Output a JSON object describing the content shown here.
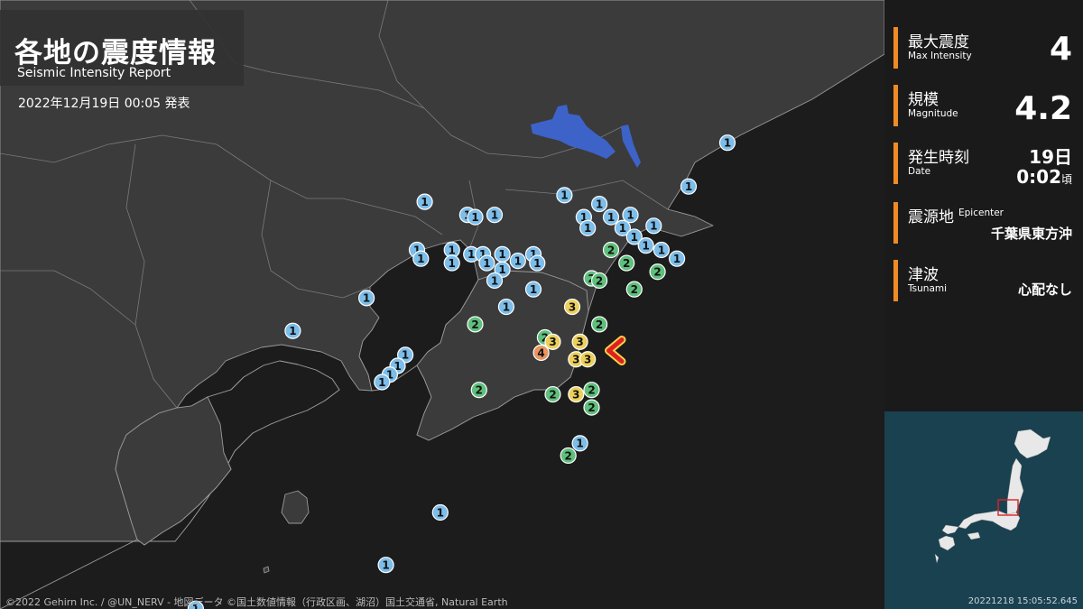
{
  "header": {
    "title_ja": "各地の震度情報",
    "title_en": "Seismic Intensity Report",
    "issued": "2022年12月19日 00:05 発表"
  },
  "credit": "©2022 Gehirn Inc. / @UN_NERV - 地図データ ©国土数値情報（行政区画、湖沼）国土交通省, Natural Earth",
  "panel": {
    "max_intensity": {
      "label_ja": "最大震度",
      "label_en": "Max Intensity",
      "value": "4"
    },
    "magnitude": {
      "label_ja": "規模",
      "label_en": "Magnitude",
      "value": "4.2"
    },
    "time": {
      "label_ja": "発生時刻",
      "label_en": "Date",
      "day": "19日",
      "time": "0:02",
      "suffix": "頃"
    },
    "epicenter": {
      "label_ja": "震源地",
      "label_en": "Epicenter",
      "value": "千葉県東方沖"
    },
    "tsunami": {
      "label_ja": "津波",
      "label_en": "Tsunami",
      "value": "心配なし"
    }
  },
  "inset": {
    "timestamp": "20221218 15:05:52.645"
  },
  "colors": {
    "land": "#3a3a3a",
    "sea": "#1c1c1c",
    "lake": "#3d63c9",
    "accent": "#f08a24",
    "int1": "#7cbde9",
    "int2": "#5fbf7c",
    "int3": "#ecd05a",
    "int4": "#e89560",
    "epicenter": "#e02020"
  },
  "stations": [
    {
      "i": 1,
      "lon": 140.8,
      "lat": 35.955
    },
    {
      "i": 1,
      "lon": 140.7,
      "lat": 35.855
    },
    {
      "i": 1,
      "lon": 140.38,
      "lat": 35.835
    },
    {
      "i": 1,
      "lon": 140.47,
      "lat": 35.815
    },
    {
      "i": 1,
      "lon": 140.55,
      "lat": 35.79
    },
    {
      "i": 1,
      "lon": 140.43,
      "lat": 35.785
    },
    {
      "i": 1,
      "lon": 140.5,
      "lat": 35.785
    },
    {
      "i": 1,
      "lon": 140.61,
      "lat": 35.765
    },
    {
      "i": 1,
      "lon": 140.44,
      "lat": 35.76
    },
    {
      "i": 1,
      "lon": 140.53,
      "lat": 35.76
    },
    {
      "i": 1,
      "lon": 140.56,
      "lat": 35.74
    },
    {
      "i": 1,
      "lon": 140.59,
      "lat": 35.72
    },
    {
      "i": 1,
      "lon": 140.63,
      "lat": 35.71
    },
    {
      "i": 1,
      "lon": 140.67,
      "lat": 35.69
    },
    {
      "i": 1,
      "lon": 140.02,
      "lat": 35.82
    },
    {
      "i": 1,
      "lon": 140.13,
      "lat": 35.79
    },
    {
      "i": 1,
      "lon": 140.15,
      "lat": 35.785
    },
    {
      "i": 1,
      "lon": 140.2,
      "lat": 35.79
    },
    {
      "i": 1,
      "lon": 140.0,
      "lat": 35.71
    },
    {
      "i": 1,
      "lon": 140.01,
      "lat": 35.69
    },
    {
      "i": 1,
      "lon": 140.09,
      "lat": 35.71
    },
    {
      "i": 1,
      "lon": 140.14,
      "lat": 35.7
    },
    {
      "i": 1,
      "lon": 140.17,
      "lat": 35.7
    },
    {
      "i": 1,
      "lon": 140.18,
      "lat": 35.68
    },
    {
      "i": 1,
      "lon": 140.22,
      "lat": 35.7
    },
    {
      "i": 1,
      "lon": 140.26,
      "lat": 35.685
    },
    {
      "i": 1,
      "lon": 140.3,
      "lat": 35.7
    },
    {
      "i": 1,
      "lon": 140.09,
      "lat": 35.68
    },
    {
      "i": 1,
      "lon": 140.22,
      "lat": 35.665
    },
    {
      "i": 1,
      "lon": 140.31,
      "lat": 35.68
    },
    {
      "i": 1,
      "lon": 140.2,
      "lat": 35.64
    },
    {
      "i": 1,
      "lon": 140.3,
      "lat": 35.62
    },
    {
      "i": 1,
      "lon": 140.23,
      "lat": 35.58
    },
    {
      "i": 1,
      "lon": 139.87,
      "lat": 35.6
    },
    {
      "i": 1,
      "lon": 139.68,
      "lat": 35.525
    },
    {
      "i": 1,
      "lon": 139.97,
      "lat": 35.47
    },
    {
      "i": 1,
      "lon": 139.95,
      "lat": 35.445
    },
    {
      "i": 1,
      "lon": 139.93,
      "lat": 35.425
    },
    {
      "i": 1,
      "lon": 139.91,
      "lat": 35.408
    },
    {
      "i": 1,
      "lon": 140.42,
      "lat": 35.268
    },
    {
      "i": 1,
      "lon": 140.06,
      "lat": 35.11
    },
    {
      "i": 1,
      "lon": 139.92,
      "lat": 34.99
    },
    {
      "i": 1,
      "lon": 139.43,
      "lat": 34.89
    },
    {
      "i": 2,
      "lon": 140.5,
      "lat": 35.71
    },
    {
      "i": 2,
      "lon": 140.54,
      "lat": 35.68
    },
    {
      "i": 2,
      "lon": 140.62,
      "lat": 35.66
    },
    {
      "i": 2,
      "lon": 140.45,
      "lat": 35.645
    },
    {
      "i": 2,
      "lon": 140.47,
      "lat": 35.64
    },
    {
      "i": 2,
      "lon": 140.56,
      "lat": 35.62
    },
    {
      "i": 2,
      "lon": 140.15,
      "lat": 35.54
    },
    {
      "i": 2,
      "lon": 140.33,
      "lat": 35.51
    },
    {
      "i": 2,
      "lon": 140.47,
      "lat": 35.54
    },
    {
      "i": 2,
      "lon": 140.16,
      "lat": 35.39
    },
    {
      "i": 2,
      "lon": 140.35,
      "lat": 35.38
    },
    {
      "i": 2,
      "lon": 140.45,
      "lat": 35.39
    },
    {
      "i": 2,
      "lon": 140.45,
      "lat": 35.35
    },
    {
      "i": 2,
      "lon": 140.39,
      "lat": 35.24
    },
    {
      "i": 3,
      "lon": 140.4,
      "lat": 35.58
    },
    {
      "i": 3,
      "lon": 140.35,
      "lat": 35.5
    },
    {
      "i": 3,
      "lon": 140.42,
      "lat": 35.5
    },
    {
      "i": 3,
      "lon": 140.41,
      "lat": 35.46
    },
    {
      "i": 3,
      "lon": 140.44,
      "lat": 35.46
    },
    {
      "i": 3,
      "lon": 140.41,
      "lat": 35.38
    },
    {
      "i": 4,
      "lon": 140.32,
      "lat": 35.475
    }
  ],
  "epicenter_point": {
    "lon": 140.5,
    "lat": 35.48
  }
}
